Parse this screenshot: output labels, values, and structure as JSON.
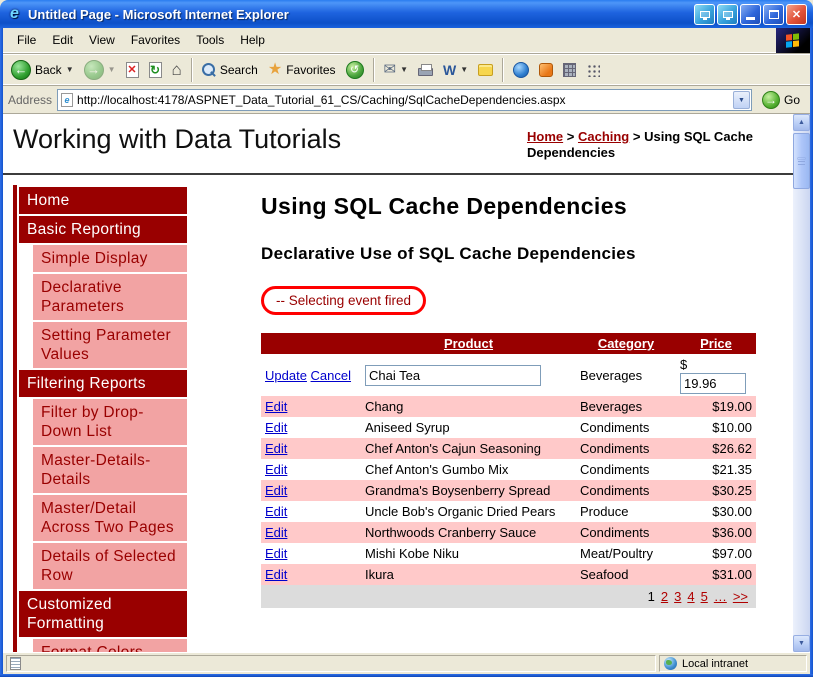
{
  "window": {
    "title": "Untitled Page - Microsoft Internet Explorer"
  },
  "menu": {
    "items": [
      "File",
      "Edit",
      "View",
      "Favorites",
      "Tools",
      "Help"
    ]
  },
  "toolbar": {
    "back_label": "Back",
    "search_label": "Search",
    "favorites_label": "Favorites"
  },
  "address": {
    "label": "Address",
    "url": "http://localhost:4178/ASPNET_Data_Tutorial_61_CS/Caching/SqlCacheDependencies.aspx",
    "go_label": "Go"
  },
  "page": {
    "site_title": "Working with Data Tutorials",
    "breadcrumb": {
      "home": "Home",
      "section": "Caching",
      "current": "Using SQL Cache Dependencies",
      "separator": ">"
    },
    "sidebar": {
      "items": [
        {
          "label": "Home"
        },
        {
          "label": "Basic Reporting"
        },
        {
          "label": "Simple Display"
        },
        {
          "label": "Declarative Parameters"
        },
        {
          "label": "Setting Parameter Values"
        },
        {
          "label": "Filtering Reports"
        },
        {
          "label": "Filter by Drop-Down List"
        },
        {
          "label": "Master-Details-Details"
        },
        {
          "label": "Master/Detail Across Two Pages"
        },
        {
          "label": "Details of Selected Row"
        },
        {
          "label": "Customized Formatting"
        },
        {
          "label": "Format Colors"
        }
      ]
    },
    "h1": "Using SQL Cache Dependencies",
    "h2": "Declarative Use of SQL Cache Dependencies",
    "event_message": "-- Selecting event fired",
    "grid": {
      "headers": {
        "product": "Product",
        "category": "Category",
        "price": "Price"
      },
      "edit_row": {
        "update": "Update",
        "cancel": "Cancel",
        "product": "Chai Tea",
        "category": "Beverages",
        "currency": "$",
        "price": "19.96"
      },
      "rows": [
        {
          "edit": "Edit",
          "product": "Chang",
          "category": "Beverages",
          "price": "$19.00"
        },
        {
          "edit": "Edit",
          "product": "Aniseed Syrup",
          "category": "Condiments",
          "price": "$10.00"
        },
        {
          "edit": "Edit",
          "product": "Chef Anton's Cajun Seasoning",
          "category": "Condiments",
          "price": "$26.62"
        },
        {
          "edit": "Edit",
          "product": "Chef Anton's Gumbo Mix",
          "category": "Condiments",
          "price": "$21.35"
        },
        {
          "edit": "Edit",
          "product": "Grandma's Boysenberry Spread",
          "category": "Condiments",
          "price": "$30.25"
        },
        {
          "edit": "Edit",
          "product": "Uncle Bob's Organic Dried Pears",
          "category": "Produce",
          "price": "$30.00"
        },
        {
          "edit": "Edit",
          "product": "Northwoods Cranberry Sauce",
          "category": "Condiments",
          "price": "$36.00"
        },
        {
          "edit": "Edit",
          "product": "Mishi Kobe Niku",
          "category": "Meat/Poultry",
          "price": "$97.00"
        },
        {
          "edit": "Edit",
          "product": "Ikura",
          "category": "Seafood",
          "price": "$31.00"
        }
      ],
      "pager": {
        "current": "1",
        "pages": [
          "2",
          "3",
          "4",
          "5"
        ],
        "ellipsis": "…",
        "next": ">>"
      }
    }
  },
  "statusbar": {
    "zone": "Local intranet"
  },
  "glyphs": {
    "back_arrow": "←",
    "forward_arrow": "→",
    "dropdown": "▼",
    "stop": "✕",
    "refresh": "↻",
    "home": "⌂",
    "favorites_star": "★",
    "history": "↺",
    "mail": "✉",
    "word": "W",
    "close": "✕",
    "go_arrow": "→",
    "up_arrow": "▲",
    "down_arrow": "▼"
  },
  "colors": {
    "maroon": "#990000",
    "row_pink": "#FFC9C9",
    "sidebar_pink": "#F2A3A3",
    "link_blue": "#0000CC",
    "pager_link": "#B00000",
    "annotation_red": "#FF0000",
    "titlebar_blue": "#1E63DF",
    "chrome": "#ECE9D8"
  }
}
